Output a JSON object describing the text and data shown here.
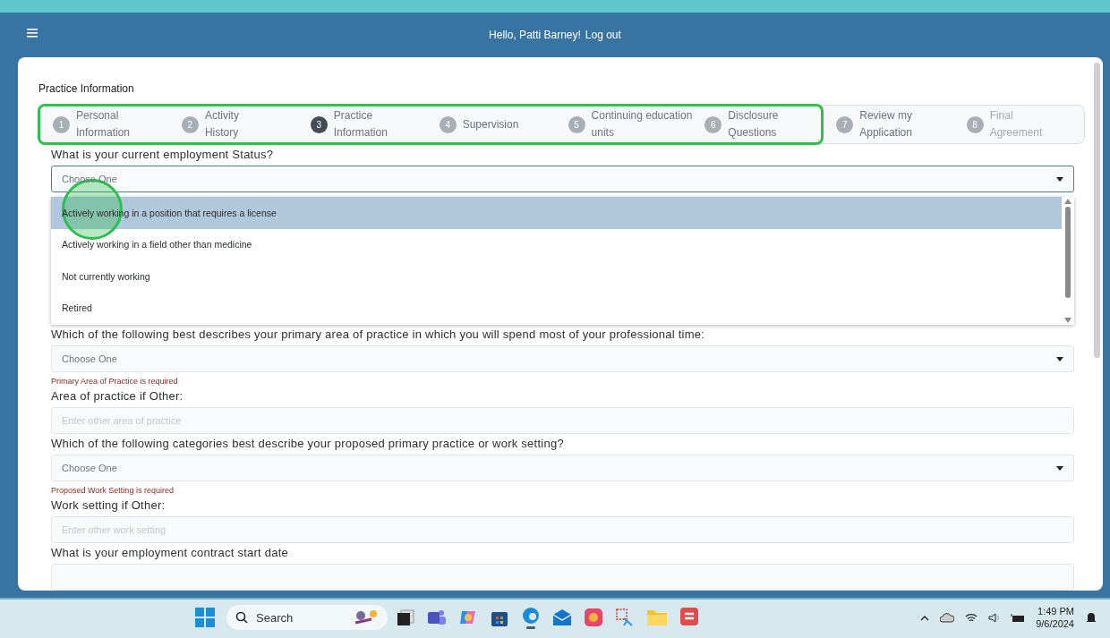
{
  "header": {
    "greeting": "Hello, Patti Barney!",
    "logout": "Log out"
  },
  "page_title": "Practice Information",
  "steps": [
    {
      "number": "1",
      "label": "Personal\nInformation",
      "selected": false,
      "disabled": false,
      "highlighted": true
    },
    {
      "number": "2",
      "label": "Activity\nHistory",
      "selected": false,
      "disabled": false,
      "highlighted": true
    },
    {
      "number": "3",
      "label": "Practice\nInformation",
      "selected": true,
      "disabled": false,
      "highlighted": true
    },
    {
      "number": "4",
      "label": "Supervision",
      "selected": false,
      "disabled": false,
      "highlighted": true
    },
    {
      "number": "5",
      "label": "Continuing education\nunits",
      "selected": false,
      "disabled": false,
      "highlighted": true
    },
    {
      "number": "6",
      "label": "Disclosure\nQuestions",
      "selected": false,
      "disabled": false,
      "highlighted": true
    },
    {
      "number": "7",
      "label": "Review my\nApplication",
      "selected": false,
      "disabled": false,
      "highlighted": false
    },
    {
      "number": "8",
      "label": "Final\nAgreement",
      "selected": false,
      "disabled": true,
      "highlighted": false
    }
  ],
  "questions": [
    {
      "kind": "select",
      "label": "What is your current employment Status?",
      "placeholder": "Choose One",
      "expanded": true,
      "options": [
        {
          "label": "Actively working in a position that requires a license",
          "selected": true
        },
        {
          "label": "Actively working in a field other than medicine",
          "selected": false
        },
        {
          "label": "Not currently working",
          "selected": false
        },
        {
          "label": "Retired",
          "selected": false
        }
      ]
    },
    {
      "kind": "select",
      "label": "Which of the following best describes your primary area of practice in which you will spend most of your professional time:",
      "placeholder": "Choose One",
      "expanded": false,
      "error": "Primary Area of Practice is required"
    },
    {
      "kind": "text",
      "label": "Area of practice if Other:",
      "placeholder": "Enter other area of practice"
    },
    {
      "kind": "select",
      "label": "Which of the following categories best describe your proposed primary practice or work setting?",
      "placeholder": "Choose One",
      "expanded": false,
      "error": "Proposed Work Setting is required"
    },
    {
      "kind": "text",
      "label": "Work setting if Other:",
      "placeholder": "Enter other work setting"
    },
    {
      "kind": "date",
      "label": "What is your employment contract start date"
    }
  ],
  "taskbar": {
    "search": "Search",
    "time": "1:49 PM",
    "date": "9/6/2024"
  }
}
